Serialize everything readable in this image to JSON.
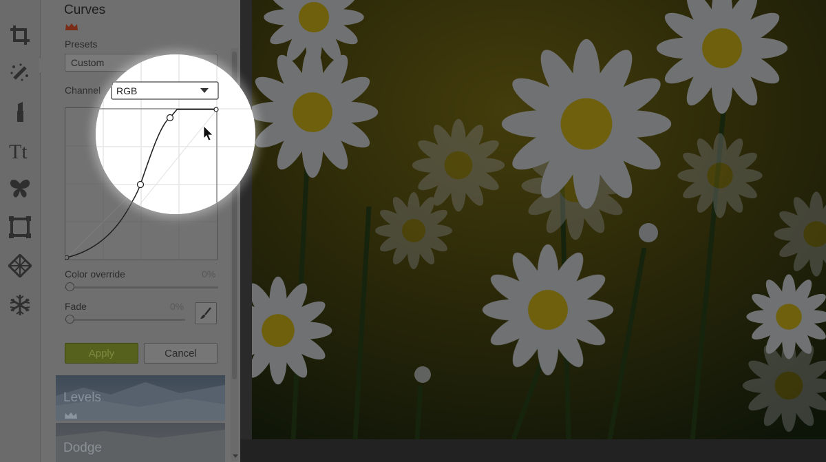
{
  "tools": [
    {
      "name": "crop-icon"
    },
    {
      "name": "magic-wand-icon"
    },
    {
      "name": "lipstick-icon"
    },
    {
      "name": "text-icon"
    },
    {
      "name": "butterfly-icon"
    },
    {
      "name": "frame-icon"
    },
    {
      "name": "texture-icon"
    },
    {
      "name": "snowflake-icon"
    }
  ],
  "panel": {
    "title": "Curves",
    "presets_label": "Presets",
    "preset_value": "Custom",
    "channel_label": "Channel",
    "channel_value": "RGB",
    "color_override": {
      "label": "Color override",
      "value": "0%"
    },
    "fade": {
      "label": "Fade",
      "value": "0%"
    },
    "apply_label": "Apply",
    "cancel_label": "Cancel",
    "effects": [
      {
        "label": "Levels",
        "premium": true
      },
      {
        "label": "Dodge",
        "premium": false
      }
    ]
  },
  "colors": {
    "dim_overlay": "rgba(0,0,0,0.55)",
    "apply_green": "#57611e",
    "photo_yellow": "#d8c51b"
  }
}
